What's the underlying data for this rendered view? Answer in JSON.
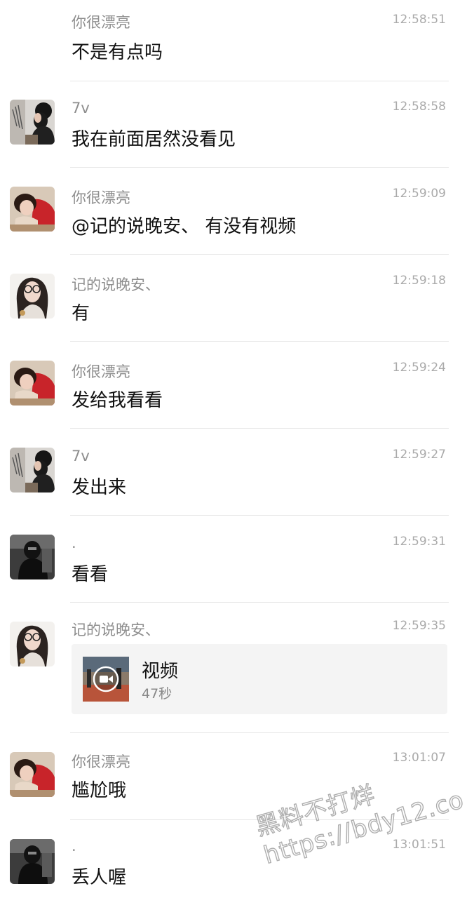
{
  "messages": [
    {
      "sender": "你很漂亮",
      "time": "12:58:51",
      "text": "不是有点吗",
      "avatar": "avatar-red-girl"
    },
    {
      "sender": "7v",
      "time": "12:58:58",
      "text": "我在前面居然没看见",
      "avatar": "avatar-dark-hair"
    },
    {
      "sender": "你很漂亮",
      "time": "12:59:09",
      "text": "@记的说晚安、 有没有视频",
      "avatar": "avatar-red-girl"
    },
    {
      "sender": "记的说晚安、",
      "time": "12:59:18",
      "text": "有",
      "avatar": "avatar-glasses-girl"
    },
    {
      "sender": "你很漂亮",
      "time": "12:59:24",
      "text": "发给我看看",
      "avatar": "avatar-red-girl"
    },
    {
      "sender": "7v",
      "time": "12:59:27",
      "text": "发出来",
      "avatar": "avatar-dark-hair"
    },
    {
      "sender": ".",
      "time": "12:59:31",
      "text": "看看",
      "avatar": "avatar-dark-figure"
    },
    {
      "sender": "记的说晚安、",
      "time": "12:59:35",
      "video": {
        "title": "视频",
        "duration": "47秒"
      },
      "avatar": "avatar-glasses-girl"
    },
    {
      "sender": "你很漂亮",
      "time": "13:01:07",
      "text": "尴尬哦",
      "avatar": "avatar-red-girl"
    },
    {
      "sender": ".",
      "time": "13:01:51",
      "text": "丢人喔",
      "avatar": "avatar-dark-figure"
    }
  ],
  "watermark": "黑料不打烊\nhttps://bdy12.co",
  "colors": {
    "name": "#8e8e8e",
    "time": "#aaaaaa",
    "divider": "#e6e6e6",
    "card": "#f4f4f4"
  }
}
